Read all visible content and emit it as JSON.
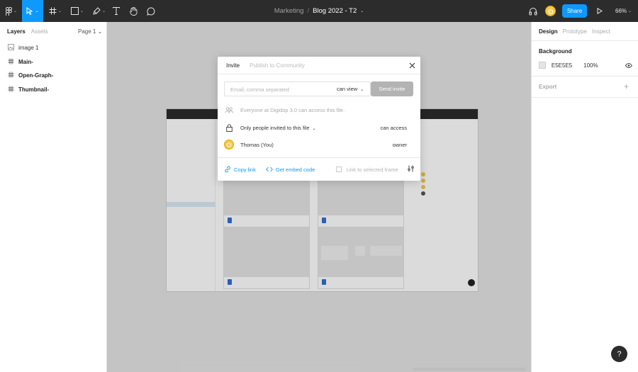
{
  "toolbar": {
    "file_folder": "Marketing",
    "file_separator": "/",
    "file_name": "Blog 2022 - T2",
    "share_label": "Share",
    "zoom_label": "66%",
    "caret": "⌄"
  },
  "left_panel": {
    "tabs": [
      "Layers",
      "Assets"
    ],
    "page_label": "Page 1 ⌄",
    "layers": [
      {
        "name": "image 1",
        "type": "image"
      },
      {
        "name": "Main-",
        "type": "frame"
      },
      {
        "name": "Open-Graph-",
        "type": "frame"
      },
      {
        "name": "Thumbnail-",
        "type": "frame"
      }
    ]
  },
  "right_panel": {
    "tabs": [
      "Design",
      "Prototype",
      "Inspect"
    ],
    "background_heading": "Background",
    "background_hex": "E5E5E5",
    "background_opacity": "100%",
    "export_heading": "Export",
    "export_plus": "+"
  },
  "modal": {
    "tabs": [
      "Invite",
      "Publish to Community"
    ],
    "email_placeholder": "Email, comma separated",
    "permission": "can view",
    "send_label": "Send invite",
    "org_row": "Everyone at Digidop 3.0 can access this file.",
    "access_row": "Only people invited to this file",
    "access_right": "can access",
    "user_name": "Thomas (You)",
    "user_role": "owner",
    "copy_link": "Copy link",
    "embed_code": "Get embed code",
    "link_selected": "Link to selected frame"
  },
  "help_label": "?",
  "colors": {
    "accent": "#0d99ff",
    "toolbar_bg": "#2c2c2c",
    "canvas_bg": "#e5e5e5",
    "avatar": "#f2c94c"
  }
}
